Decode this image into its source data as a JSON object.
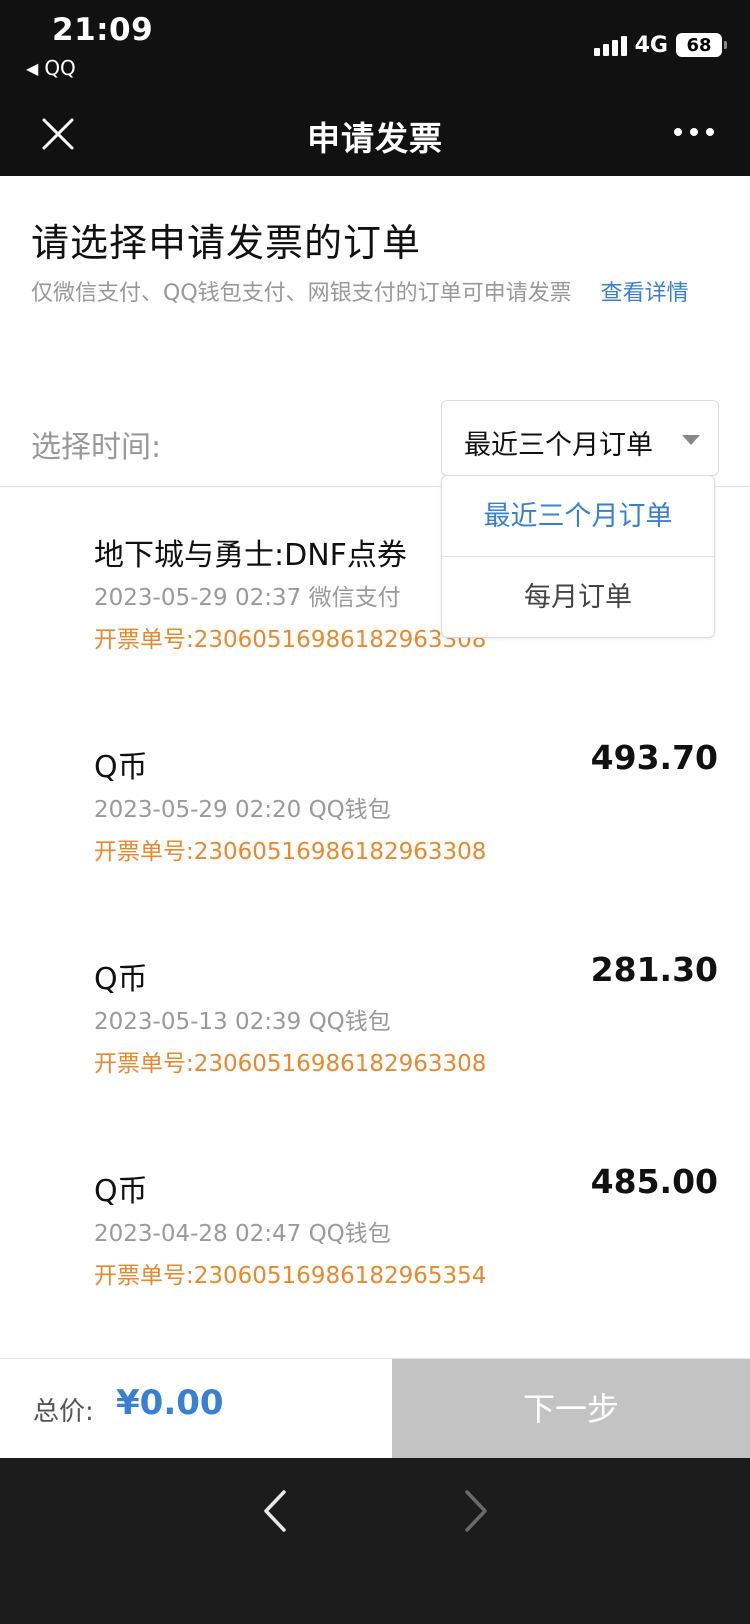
{
  "status_bar": {
    "time": "21:09",
    "back_app": "QQ",
    "network": "4G",
    "battery": "68"
  },
  "nav": {
    "title": "申请发票"
  },
  "header": {
    "heading": "请选择申请发票的订单",
    "notice": "仅微信支付、QQ钱包支付、网银支付的订单可申请发票",
    "details_link": "查看详情"
  },
  "time_filter": {
    "label": "选择时间:",
    "selected": "最近三个月订单",
    "options": [
      "最近三个月订单",
      "每月订单"
    ]
  },
  "orders": [
    {
      "name": "地下城与勇士:DNF点券",
      "datetime": "2023-05-29 02:37",
      "payment": "微信支付",
      "invoice_no": "开票单号:23060516986182963308",
      "amount": ""
    },
    {
      "name": "Q币",
      "datetime": "2023-05-29 02:20",
      "payment": "QQ钱包",
      "invoice_no": "开票单号:23060516986182963308",
      "amount": "493.70"
    },
    {
      "name": "Q币",
      "datetime": "2023-05-13 02:39",
      "payment": "QQ钱包",
      "invoice_no": "开票单号:23060516986182963308",
      "amount": "281.30"
    },
    {
      "name": "Q币",
      "datetime": "2023-04-28 02:47",
      "payment": "QQ钱包",
      "invoice_no": "开票单号:23060516986182965354",
      "amount": "485.00"
    }
  ],
  "footer": {
    "total_label": "总价:",
    "total_value": "¥0.00",
    "next_label": "下一步"
  },
  "colors": {
    "accent": "#3a80d2",
    "invoice_orange": "#e8892f",
    "dark_bar": "#111111",
    "disabled_button": "#c3c3c3"
  }
}
